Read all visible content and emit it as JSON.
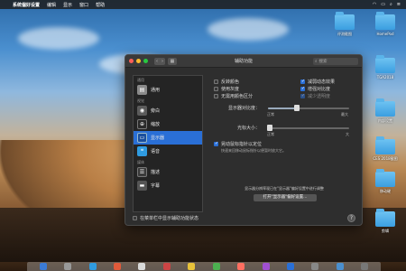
{
  "menubar": {
    "app_name": "系统偏好设置",
    "menus": [
      "编辑",
      "显示",
      "窗口",
      "帮助"
    ]
  },
  "desktop": {
    "icons": [
      {
        "label": "评测截图"
      },
      {
        "label": "HomePod"
      },
      {
        "label": "TGA2018"
      },
      {
        "label": "内部设置"
      },
      {
        "label": "CES 2018截图"
      },
      {
        "label": "截取"
      },
      {
        "label": "移动硬"
      },
      {
        "label": "剪辑"
      }
    ]
  },
  "window": {
    "title": "辅助功能",
    "search_placeholder": "搜索"
  },
  "sidebar": {
    "sections": {
      "general": "通用",
      "vision": "视觉",
      "hearing": "听觉",
      "media": "媒体"
    },
    "items": [
      {
        "label": "通用",
        "icon": "general-icon",
        "color": "#8a8a8a"
      },
      {
        "label": "旁白",
        "icon": "voiceover-icon",
        "color": "#5b5b5b"
      },
      {
        "label": "缩放",
        "icon": "zoom-icon",
        "color": "#2a2a2a"
      },
      {
        "label": "显示器",
        "icon": "display-icon",
        "color": "#2a6fd6"
      },
      {
        "label": "语音",
        "icon": "speech-icon",
        "color": "#2f9be0"
      },
      {
        "label": "描述",
        "icon": "descriptions-icon",
        "color": "#3a3a3a"
      },
      {
        "label": "字幕",
        "icon": "captions-icon",
        "color": "#555555"
      }
    ],
    "selected_index": 3
  },
  "options": {
    "invert_colors": "反转颜色",
    "use_grayscale": "使用灰度",
    "differentiate_without_color": "无需用颜色区分",
    "reduce_motion": "减弱动态效果",
    "increase_contrast": "增强对比度",
    "reduce_transparency": "减少透明度",
    "invert_checked": false,
    "grayscale_checked": false,
    "differentiate_checked": false,
    "reduce_motion_checked": true,
    "increase_contrast_checked": true,
    "reduce_transparency_checked": true
  },
  "contrast": {
    "label": "显示器对比度：",
    "min": "正常",
    "max": "最大",
    "level": 0.35
  },
  "cursor": {
    "label": "光标大小：",
    "min": "正常",
    "max": "大",
    "level": 0.02
  },
  "shake": {
    "label": "晃动鼠标指针以定位",
    "desc": "快速来回移动鼠标指针以便暂时放大它。",
    "checked": true
  },
  "notice": {
    "text": "显示器分辨率现已在\"显示器\"偏好设置中进行调整",
    "button": "打开\"显示器\"偏好设置..."
  },
  "footer": {
    "menu_status": "在菜单栏中显示辅助功能状态",
    "help": "?"
  }
}
